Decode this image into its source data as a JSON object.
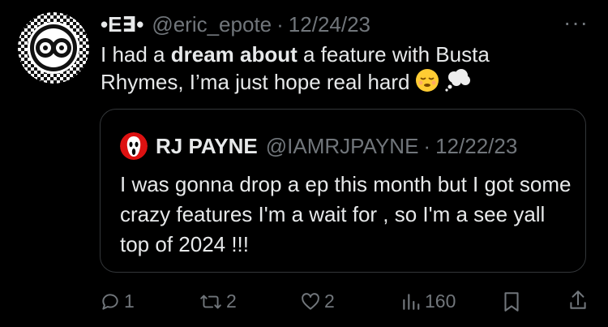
{
  "tweet": {
    "display_name": "•E∃•",
    "handle": "@eric_epote",
    "date": "12/24/23",
    "separator": "·",
    "more_label": "···",
    "text_before": "I had a ",
    "text_bold": "dream about",
    "text_after": " a feature with Busta Rhymes, I’ma just hope real hard"
  },
  "quote": {
    "display_name": "RJ PAYNE",
    "handle": "@IAMRJPAYNE",
    "date": "12/22/23",
    "separator": "·",
    "text": "I was gonna drop a ep this month but I got some crazy features I'm a wait for , so I'm a see yall top of 2024 !!!"
  },
  "actions": {
    "replies": "1",
    "retweets": "2",
    "likes": "2",
    "views": "160"
  },
  "colors": {
    "background": "#000000",
    "text": "#e7e9ea",
    "secondary": "#71767b",
    "border": "#333639"
  },
  "icons": [
    "reply-icon",
    "retweet-icon",
    "like-icon",
    "views-icon",
    "bookmark-icon",
    "share-icon",
    "more-icon"
  ]
}
